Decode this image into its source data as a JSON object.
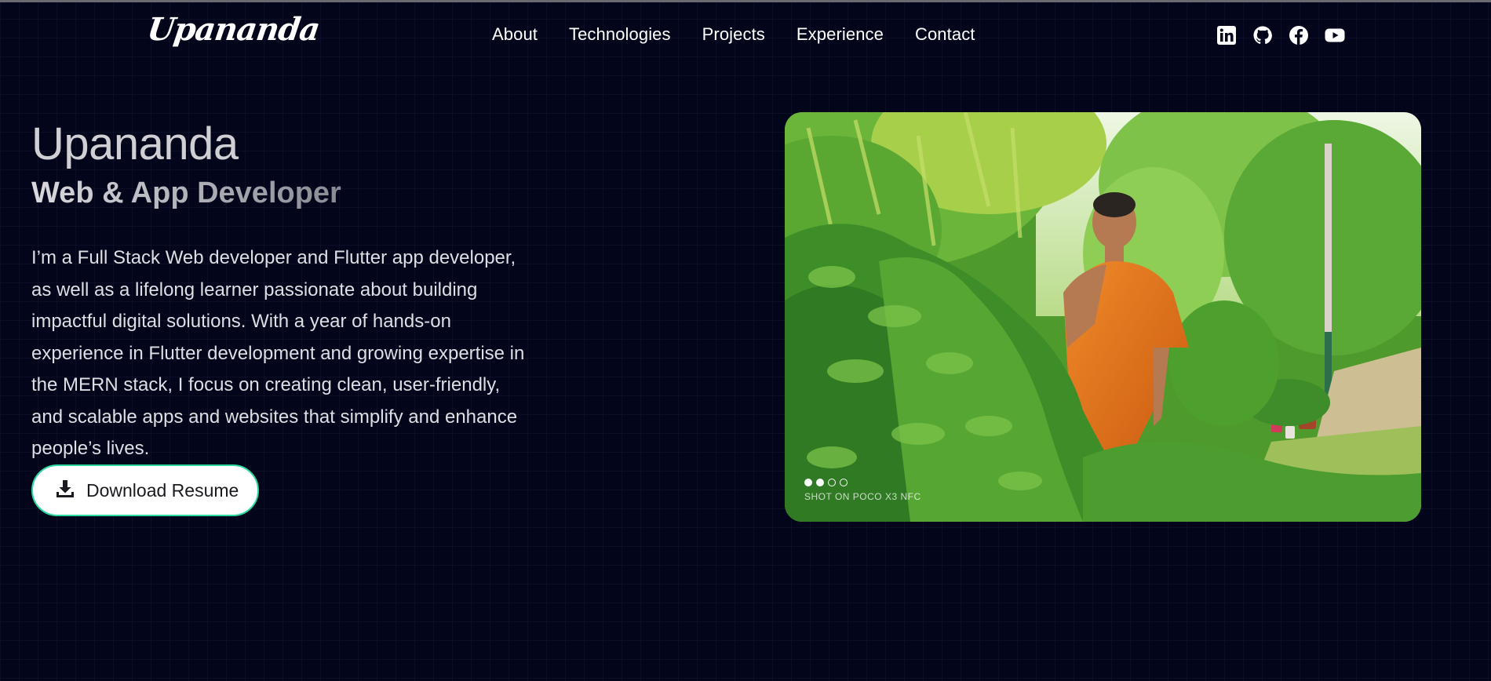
{
  "brand": {
    "logo_text": "Upananda"
  },
  "nav": {
    "items": [
      {
        "label": "About"
      },
      {
        "label": "Technologies"
      },
      {
        "label": "Projects"
      },
      {
        "label": "Experience"
      },
      {
        "label": "Contact"
      }
    ]
  },
  "social": {
    "icons": [
      "linkedin-icon",
      "github-icon",
      "facebook-icon",
      "youtube-icon"
    ]
  },
  "hero": {
    "name": "Upananda",
    "role": "Web & App Developer",
    "description": "I’m a Full Stack Web developer and Flutter app developer, as well as a lifelong learner passionate about building impactful digital solutions. With a year of hands-on experience in Flutter development and growing expertise in the MERN stack, I focus on creating clean, user-friendly, and scalable apps and websites that simplify and enhance people’s lives.",
    "download_label": "Download Resume",
    "photo_watermark": "SHOT ON POCO X3 NFC"
  },
  "colors": {
    "background": "#03061a",
    "accent_border": "#2bd8a0",
    "robe": "#e0701a",
    "foliage": "#3f9d2a"
  }
}
